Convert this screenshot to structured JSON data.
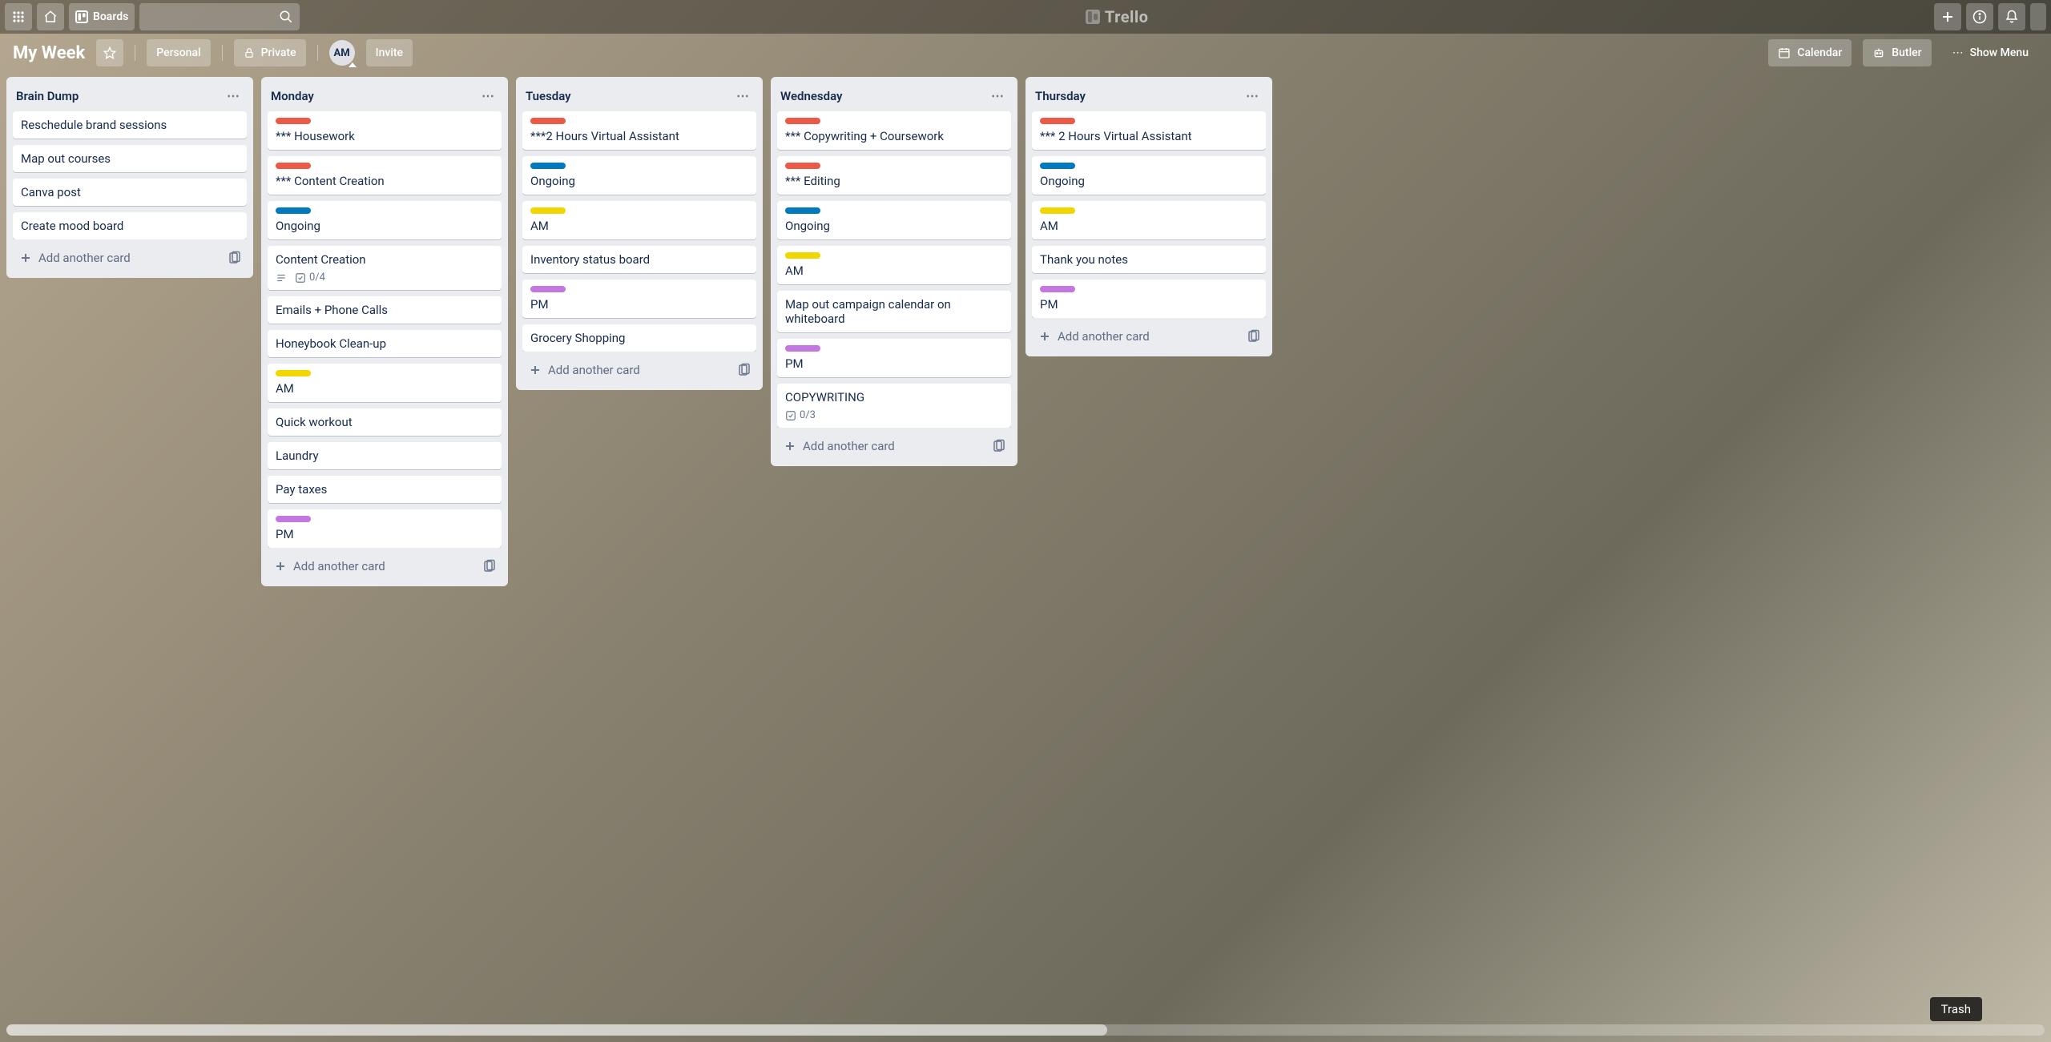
{
  "header": {
    "boards_label": "Boards",
    "logo_text": "Trello"
  },
  "boardbar": {
    "name": "My Week",
    "personal": "Personal",
    "private": "Private",
    "avatar_initials": "AM",
    "invite": "Invite",
    "calendar": "Calendar",
    "butler": "Butler",
    "show_menu": "Show Menu"
  },
  "add_card_label": "Add another card",
  "tooltip": "Trash",
  "lists": [
    {
      "title": "Brain Dump",
      "cards": [
        {
          "title": "Reschedule brand sessions"
        },
        {
          "title": "Map out courses"
        },
        {
          "title": "Canva post"
        },
        {
          "title": "Create mood board"
        }
      ]
    },
    {
      "title": "Monday",
      "cards": [
        {
          "labels": [
            "red"
          ],
          "title": "*** Housework"
        },
        {
          "labels": [
            "red"
          ],
          "title": "*** Content Creation"
        },
        {
          "labels": [
            "blue"
          ],
          "title": "Ongoing"
        },
        {
          "title": "Content Creation",
          "checklist": "0/4",
          "has_desc": true
        },
        {
          "title": "Emails + Phone Calls"
        },
        {
          "title": "Honeybook Clean-up"
        },
        {
          "labels": [
            "yellow"
          ],
          "title": "AM"
        },
        {
          "title": "Quick workout"
        },
        {
          "title": "Laundry"
        },
        {
          "title": "Pay taxes"
        },
        {
          "labels": [
            "purple"
          ],
          "title": "PM"
        }
      ]
    },
    {
      "title": "Tuesday",
      "cards": [
        {
          "labels": [
            "red"
          ],
          "title": "***2 Hours Virtual Assistant"
        },
        {
          "labels": [
            "blue"
          ],
          "title": "Ongoing"
        },
        {
          "labels": [
            "yellow"
          ],
          "title": "AM"
        },
        {
          "title": "Inventory status board"
        },
        {
          "labels": [
            "purple"
          ],
          "title": "PM"
        },
        {
          "title": "Grocery Shopping"
        }
      ]
    },
    {
      "title": "Wednesday",
      "cards": [
        {
          "labels": [
            "red"
          ],
          "title": "*** Copywriting + Coursework"
        },
        {
          "labels": [
            "red"
          ],
          "title": "*** Editing"
        },
        {
          "labels": [
            "blue"
          ],
          "title": "Ongoing"
        },
        {
          "labels": [
            "yellow"
          ],
          "title": "AM"
        },
        {
          "title": "Map out campaign calendar on whiteboard"
        },
        {
          "labels": [
            "purple"
          ],
          "title": "PM"
        },
        {
          "title": "COPYWRITING",
          "checklist": "0/3"
        }
      ]
    },
    {
      "title": "Thursday",
      "cards": [
        {
          "labels": [
            "red"
          ],
          "title": "*** 2 Hours Virtual Assistant"
        },
        {
          "labels": [
            "blue"
          ],
          "title": "Ongoing"
        },
        {
          "labels": [
            "yellow"
          ],
          "title": "AM"
        },
        {
          "title": "Thank you notes"
        },
        {
          "labels": [
            "purple"
          ],
          "title": "PM"
        }
      ]
    }
  ]
}
